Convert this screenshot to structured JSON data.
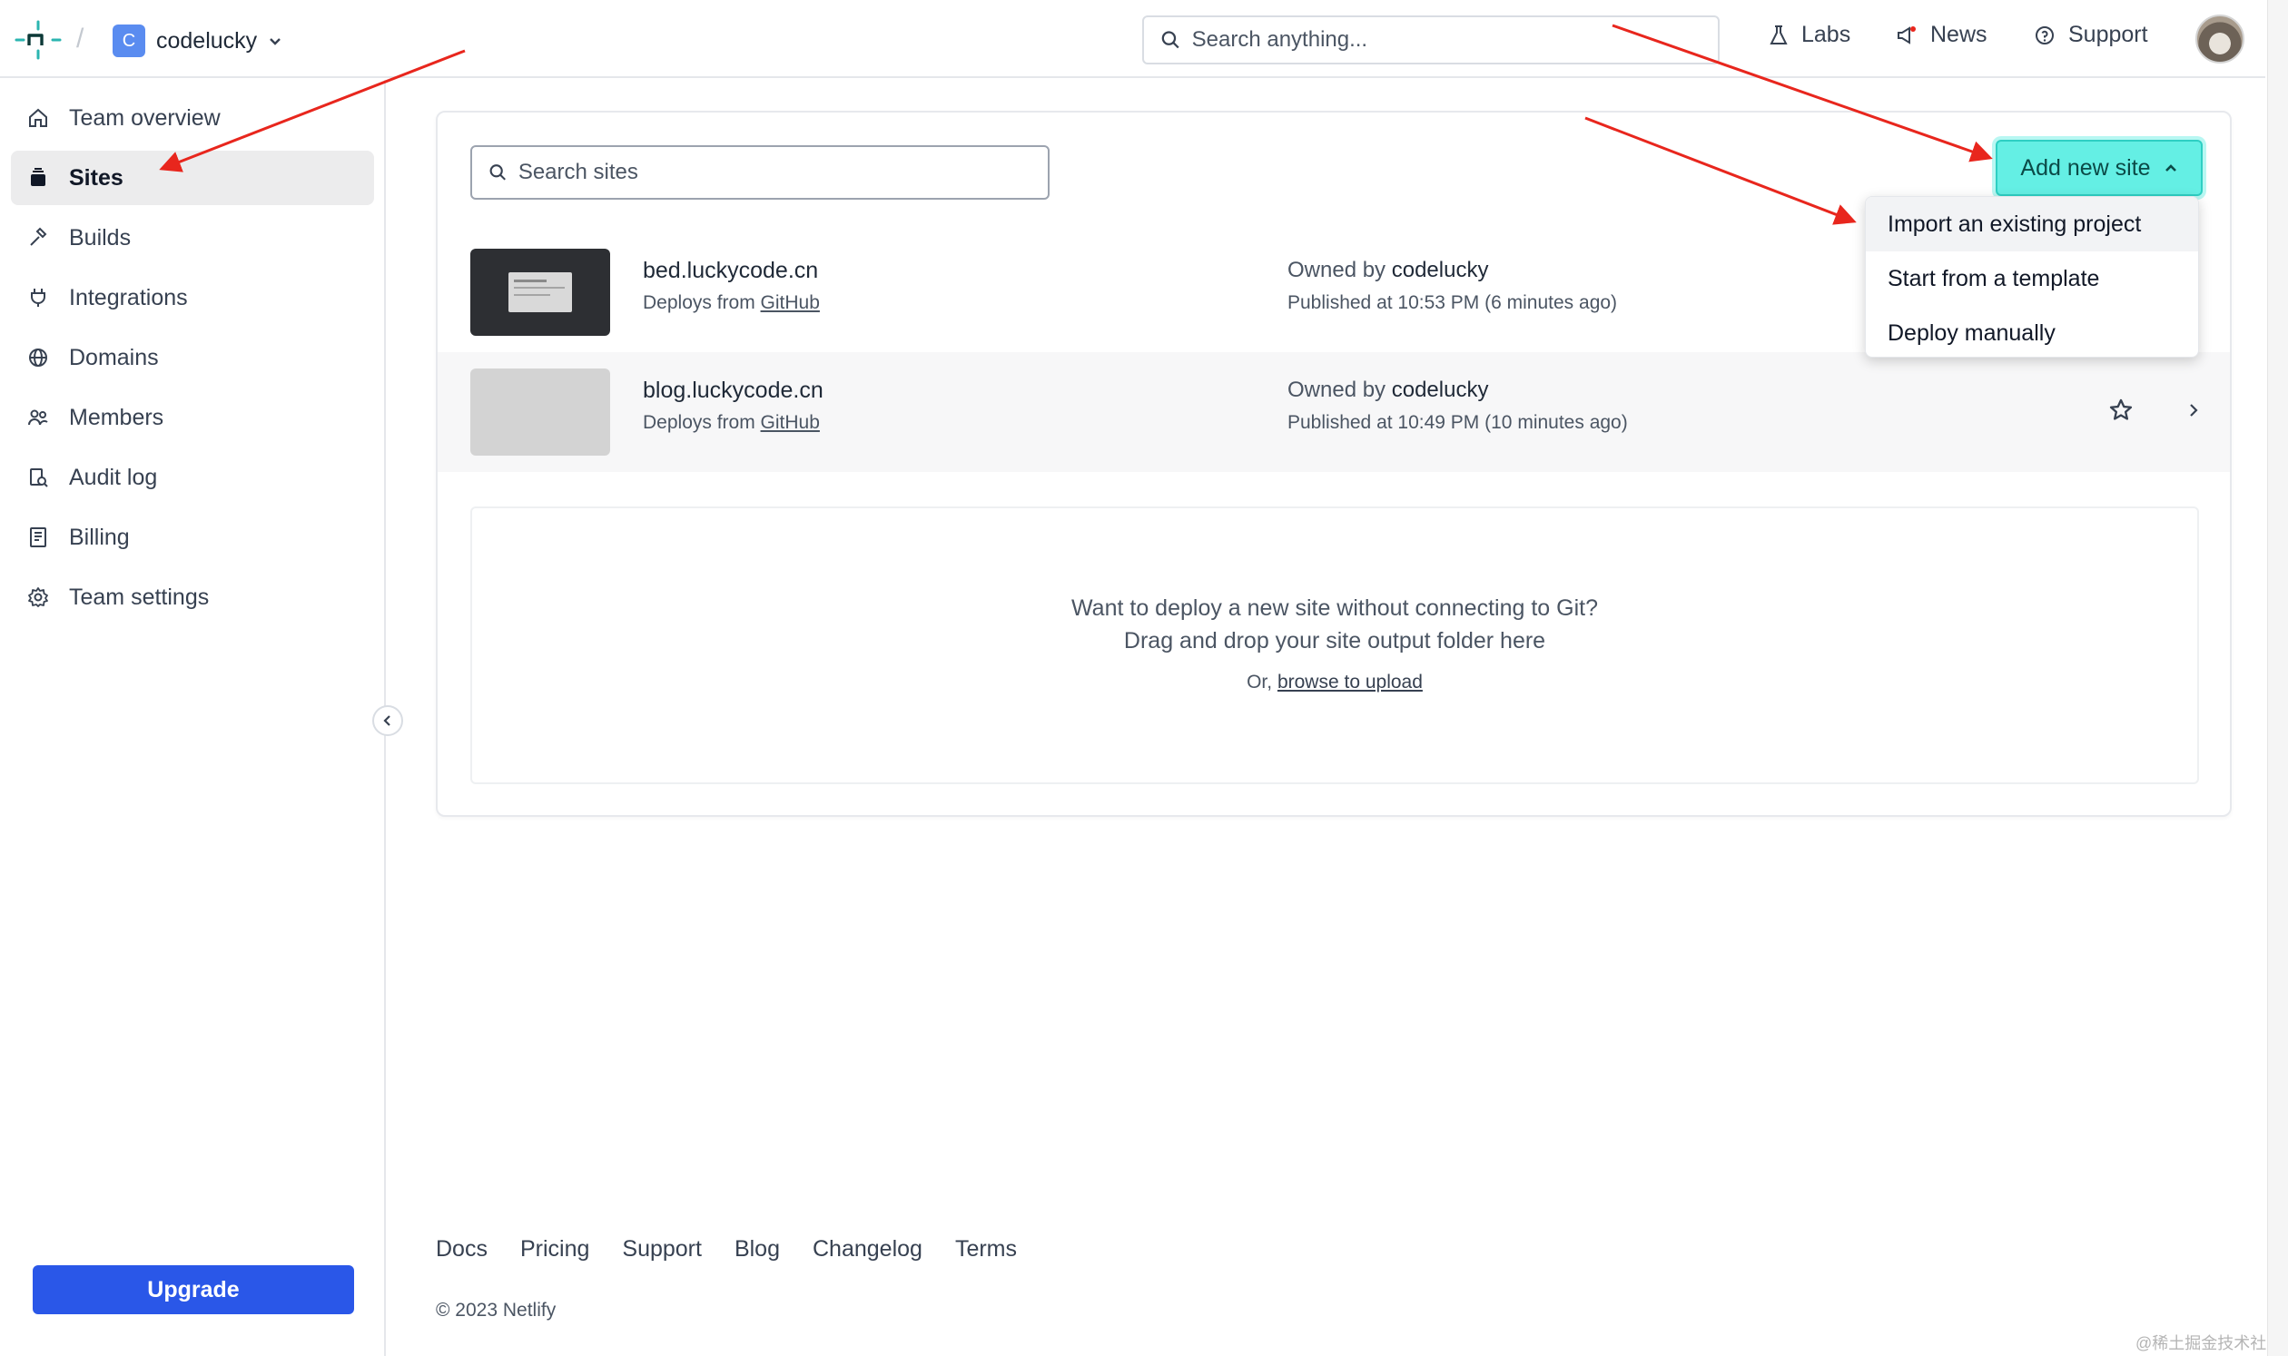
{
  "topbar": {
    "team_initial": "C",
    "team_name": "codelucky",
    "search_placeholder": "Search anything...",
    "nav": [
      {
        "label": "Labs",
        "icon": "flask-icon"
      },
      {
        "label": "News",
        "icon": "megaphone-icon"
      },
      {
        "label": "Support",
        "icon": "help-circle-icon"
      }
    ]
  },
  "sidebar": {
    "items": [
      {
        "label": "Team overview",
        "icon": "home-icon"
      },
      {
        "label": "Sites",
        "icon": "layers-icon",
        "active": true
      },
      {
        "label": "Builds",
        "icon": "hammer-icon"
      },
      {
        "label": "Integrations",
        "icon": "plug-icon"
      },
      {
        "label": "Domains",
        "icon": "globe-icon"
      },
      {
        "label": "Members",
        "icon": "users-icon"
      },
      {
        "label": "Audit log",
        "icon": "audit-icon"
      },
      {
        "label": "Billing",
        "icon": "receipt-icon"
      },
      {
        "label": "Team settings",
        "icon": "gear-icon"
      }
    ],
    "upgrade_label": "Upgrade"
  },
  "main": {
    "search_placeholder": "Search sites",
    "add_button_label": "Add new site",
    "menu_items": [
      "Import an existing project",
      "Start from a template",
      "Deploy manually"
    ],
    "sites": [
      {
        "name": "bed.luckycode.cn",
        "deploy_prefix": "Deploys from",
        "deploy_source": "GitHub",
        "owner_prefix": "Owned by",
        "owner": "codelucky",
        "published": "Published at 10:53 PM (6 minutes ago)"
      },
      {
        "name": "blog.luckycode.cn",
        "deploy_prefix": "Deploys from",
        "deploy_source": "GitHub",
        "owner_prefix": "Owned by",
        "owner": "codelucky",
        "published": "Published at 10:49 PM (10 minutes ago)"
      }
    ],
    "dropzone": {
      "line1": "Want to deploy a new site without connecting to Git?",
      "line2": "Drag and drop your site output folder here",
      "prefix": "Or,",
      "link": "browse to upload"
    }
  },
  "footer": {
    "links": [
      "Docs",
      "Pricing",
      "Support",
      "Blog",
      "Changelog",
      "Terms"
    ],
    "copyright": "© 2023 Netlify"
  },
  "watermark": "@稀土掘金技术社区",
  "colors": {
    "primary": "#2a57e8",
    "accent_teal": "#64efe4",
    "annotation_red": "#e8261d"
  }
}
